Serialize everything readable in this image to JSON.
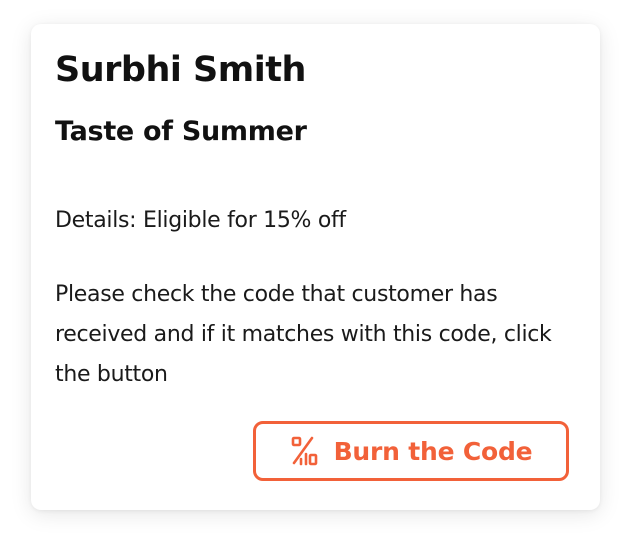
{
  "card": {
    "customer_name": "Surbhi Smith",
    "offer_title": "Taste of Summer",
    "details": "Details: Eligible for 15% off",
    "instructions": "Please check the code that customer has received and if it matches with this code, click the button",
    "button": {
      "label": "Burn the Code",
      "icon": "percent-discount-icon"
    }
  },
  "colors": {
    "accent": "#f26139",
    "text": "#111111",
    "background": "#ffffff"
  }
}
